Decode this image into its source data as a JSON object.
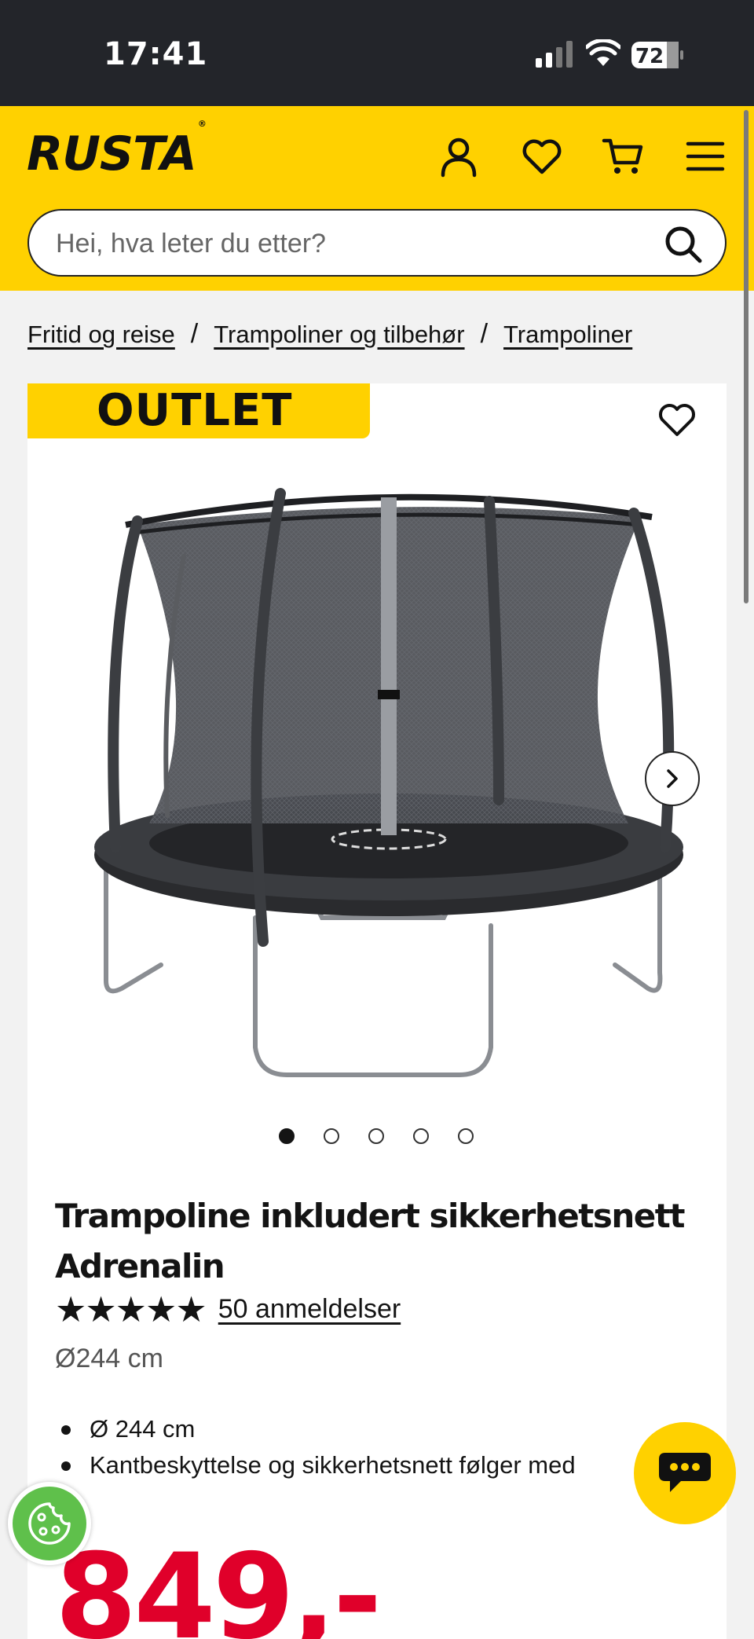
{
  "status_bar": {
    "time": "17:41",
    "battery": "72"
  },
  "header": {
    "logo": "RUSTA",
    "search": {
      "placeholder": "Hei, hva leter du etter?"
    },
    "icons": [
      "user-icon",
      "heart-icon",
      "cart-icon",
      "menu-icon"
    ],
    "background_color": "#ffd100"
  },
  "breadcrumb": {
    "items": [
      "Fritid og reise",
      "Trampoliner og tilbehør",
      "Trampoliner"
    ],
    "separator": "/"
  },
  "product": {
    "badge": "OUTLET",
    "image_icon": "trampoline-image",
    "carousel": {
      "total": 5,
      "active": 1
    },
    "title": "Trampoline inkludert sikkerhetsnett Adrenalin",
    "rating": {
      "stars": "★★★★★",
      "value": 5,
      "reviews_label": "50 anmeldelser"
    },
    "variant": "Ø244 cm",
    "bullets": [
      "Ø 244 cm",
      "Kantbeskyttelse og sikkerhetsnett følger med"
    ],
    "price": "849,-",
    "price_color": "#e0002a"
  },
  "floating": {
    "chat_icon": "chat-icon",
    "cookie_icon": "cookie-icon"
  }
}
